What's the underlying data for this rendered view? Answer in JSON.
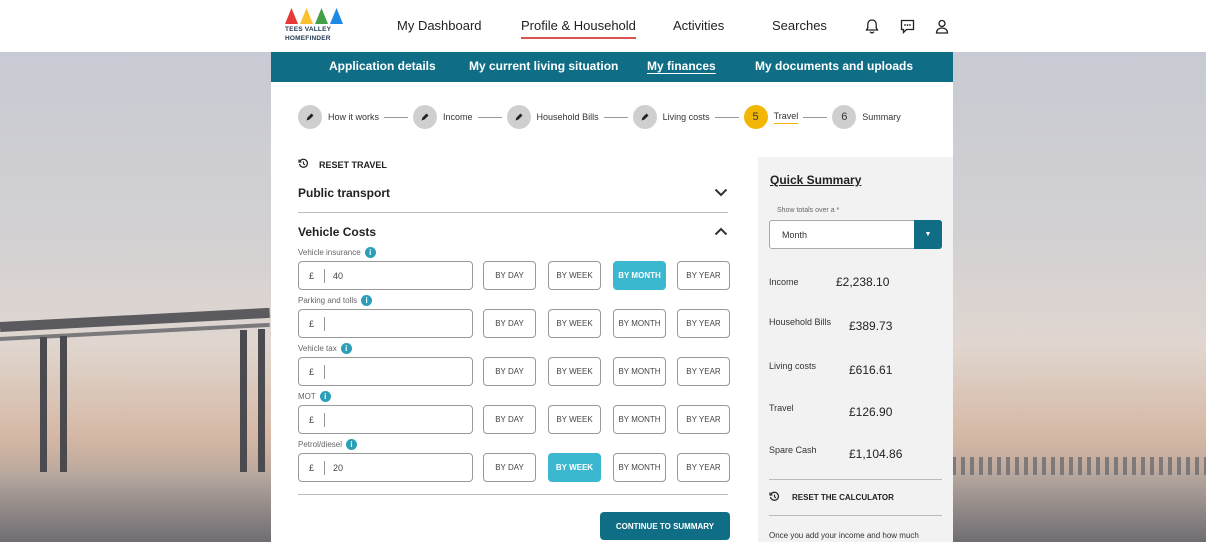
{
  "brand": {
    "line1": "TEES VALLEY",
    "line2": "HOMEFINDER",
    "colors": [
      "#e53935",
      "#fbc02d",
      "#43a047",
      "#1e88e5"
    ]
  },
  "topnav": {
    "items": [
      {
        "label": "My Dashboard"
      },
      {
        "label": "Profile & Household",
        "active": true
      },
      {
        "label": "Activities"
      },
      {
        "label": "Searches"
      }
    ],
    "icons": [
      "bell-icon",
      "chat-icon",
      "user-icon"
    ]
  },
  "subnav": {
    "items": [
      {
        "label": "Application details"
      },
      {
        "label": "My current living situation"
      },
      {
        "label": "My finances",
        "active": true
      },
      {
        "label": "My documents and uploads"
      }
    ]
  },
  "stepper": {
    "steps": [
      {
        "label": "How it works",
        "state": "done"
      },
      {
        "label": "Income",
        "state": "done"
      },
      {
        "label": "Household Bills",
        "state": "done"
      },
      {
        "label": "Living costs",
        "state": "done"
      },
      {
        "label": "Travel",
        "number": "5",
        "state": "current"
      },
      {
        "label": "Summary",
        "number": "6",
        "state": "todo"
      }
    ]
  },
  "reset_travel": "RESET TRAVEL",
  "public_transport": "Public transport",
  "vehicle_costs": {
    "title": "Vehicle Costs",
    "currency": "£",
    "period_labels": [
      "BY DAY",
      "BY WEEK",
      "BY MONTH",
      "BY YEAR"
    ],
    "fields": [
      {
        "label": "Vehicle insurance",
        "value": "40",
        "selected": "BY MONTH"
      },
      {
        "label": "Parking and tolls",
        "value": "",
        "selected": ""
      },
      {
        "label": "Vehicle tax",
        "value": "",
        "selected": ""
      },
      {
        "label": "MOT",
        "value": "",
        "selected": ""
      },
      {
        "label": "Petrol/diesel",
        "value": "20",
        "selected": "BY WEEK"
      }
    ]
  },
  "continue_label": "CONTINUE TO SUMMARY",
  "summary": {
    "title": "Quick Summary",
    "hint": "Show totals over a *",
    "period": "Month",
    "rows": [
      {
        "label": "Income",
        "value": "£2,238.10"
      },
      {
        "label": "Household Bills",
        "value": "£389.73"
      },
      {
        "label": "Living costs",
        "value": "£616.61"
      },
      {
        "label": "Travel",
        "value": "£126.90"
      },
      {
        "label": "Spare Cash",
        "value": "£1,104.86"
      }
    ],
    "reset_label": "RESET THE CALCULATOR",
    "note": "Once you add your income and how much"
  }
}
